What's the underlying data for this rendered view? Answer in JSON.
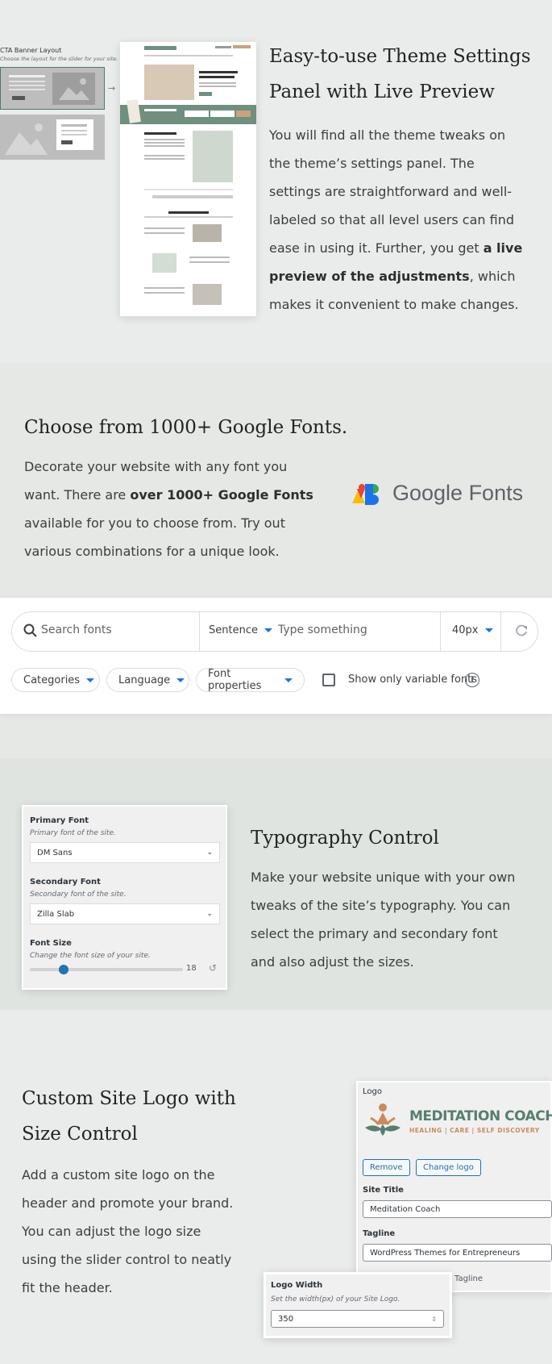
{
  "section1": {
    "title_line1": "Easy-to-use Theme Settings",
    "title_line2": "Panel with Live Preview",
    "para_lines": [
      "You will find all the theme tweaks on",
      "the theme’s settings panel. The",
      "settings are straightforward and well-",
      "labeled so that all level users can find",
      "ease in using it. Further, you get "
    ],
    "para_bold1": "a live",
    "para_bold2": "preview of the adjustments",
    "para_after_bold": ", which",
    "para_last": "makes it convenient to make changes.",
    "cta_panel": {
      "title": "CTA Banner Layout",
      "desc": "Choose the layout for the slider for your site."
    }
  },
  "section2": {
    "title": "Choose from 1000+ Google Fonts.",
    "para_line1": "Decorate your website with any font you",
    "para_line2_pre": "want. There are ",
    "para_line2_bold": "over 1000+ Google Fonts",
    "para_line3": "available for you to choose from. Try out",
    "para_line4": "various combinations for a unique look.",
    "logo_text": "Google Fonts",
    "search": {
      "placeholder": "Search fonts",
      "mode": "Sentence",
      "type_placeholder": "Type something",
      "size": "40px"
    },
    "filters": {
      "categories": "Categories",
      "language": "Language",
      "font_properties": "Font properties",
      "variable_label": "Show only variable fonts"
    }
  },
  "section3": {
    "title": "Typography Control",
    "para_lines": [
      "Make your website unique with your own",
      "tweaks of the site’s typography. You can",
      "select the primary and secondary font",
      "and also adjust the sizes."
    ],
    "panel": {
      "primary_label": "Primary Font",
      "primary_desc": "Primary font of the site.",
      "primary_value": "DM Sans",
      "secondary_label": "Secondary Font",
      "secondary_desc": "Secondary font of the site.",
      "secondary_value": "Zilla Slab",
      "size_label": "Font Size",
      "size_desc": "Change the font size of your site.",
      "size_value": "18",
      "size_fraction": 0.22
    }
  },
  "section4": {
    "title_line1": "Custom Site Logo with",
    "title_line2": "Size Control",
    "para_lines": [
      "Add a custom site logo on the",
      "header and promote your brand.",
      "You can adjust the logo size",
      "using the slider control to neatly",
      "fit the header."
    ],
    "logo_panel": {
      "label": "Logo",
      "brand_name": "MEDITATION COACH",
      "brand_tagline": "HEALING | CARE | SELF DISCOVERY",
      "remove": "Remove",
      "change": "Change logo",
      "site_title_label": "Site Title",
      "site_title_value": "Meditation Coach",
      "tagline_label": "Tagline",
      "tagline_value": "WordPress Themes for Entrepreneurs",
      "tagline_toggle": "Tagline"
    },
    "width_panel": {
      "label": "Logo Width",
      "desc": "Set the width(px) of your Site Logo.",
      "value": "350"
    }
  },
  "colors": {
    "brand_green": "#6f8f7f",
    "wp_blue": "#2271b1",
    "google_blue": "#1a73e8"
  }
}
